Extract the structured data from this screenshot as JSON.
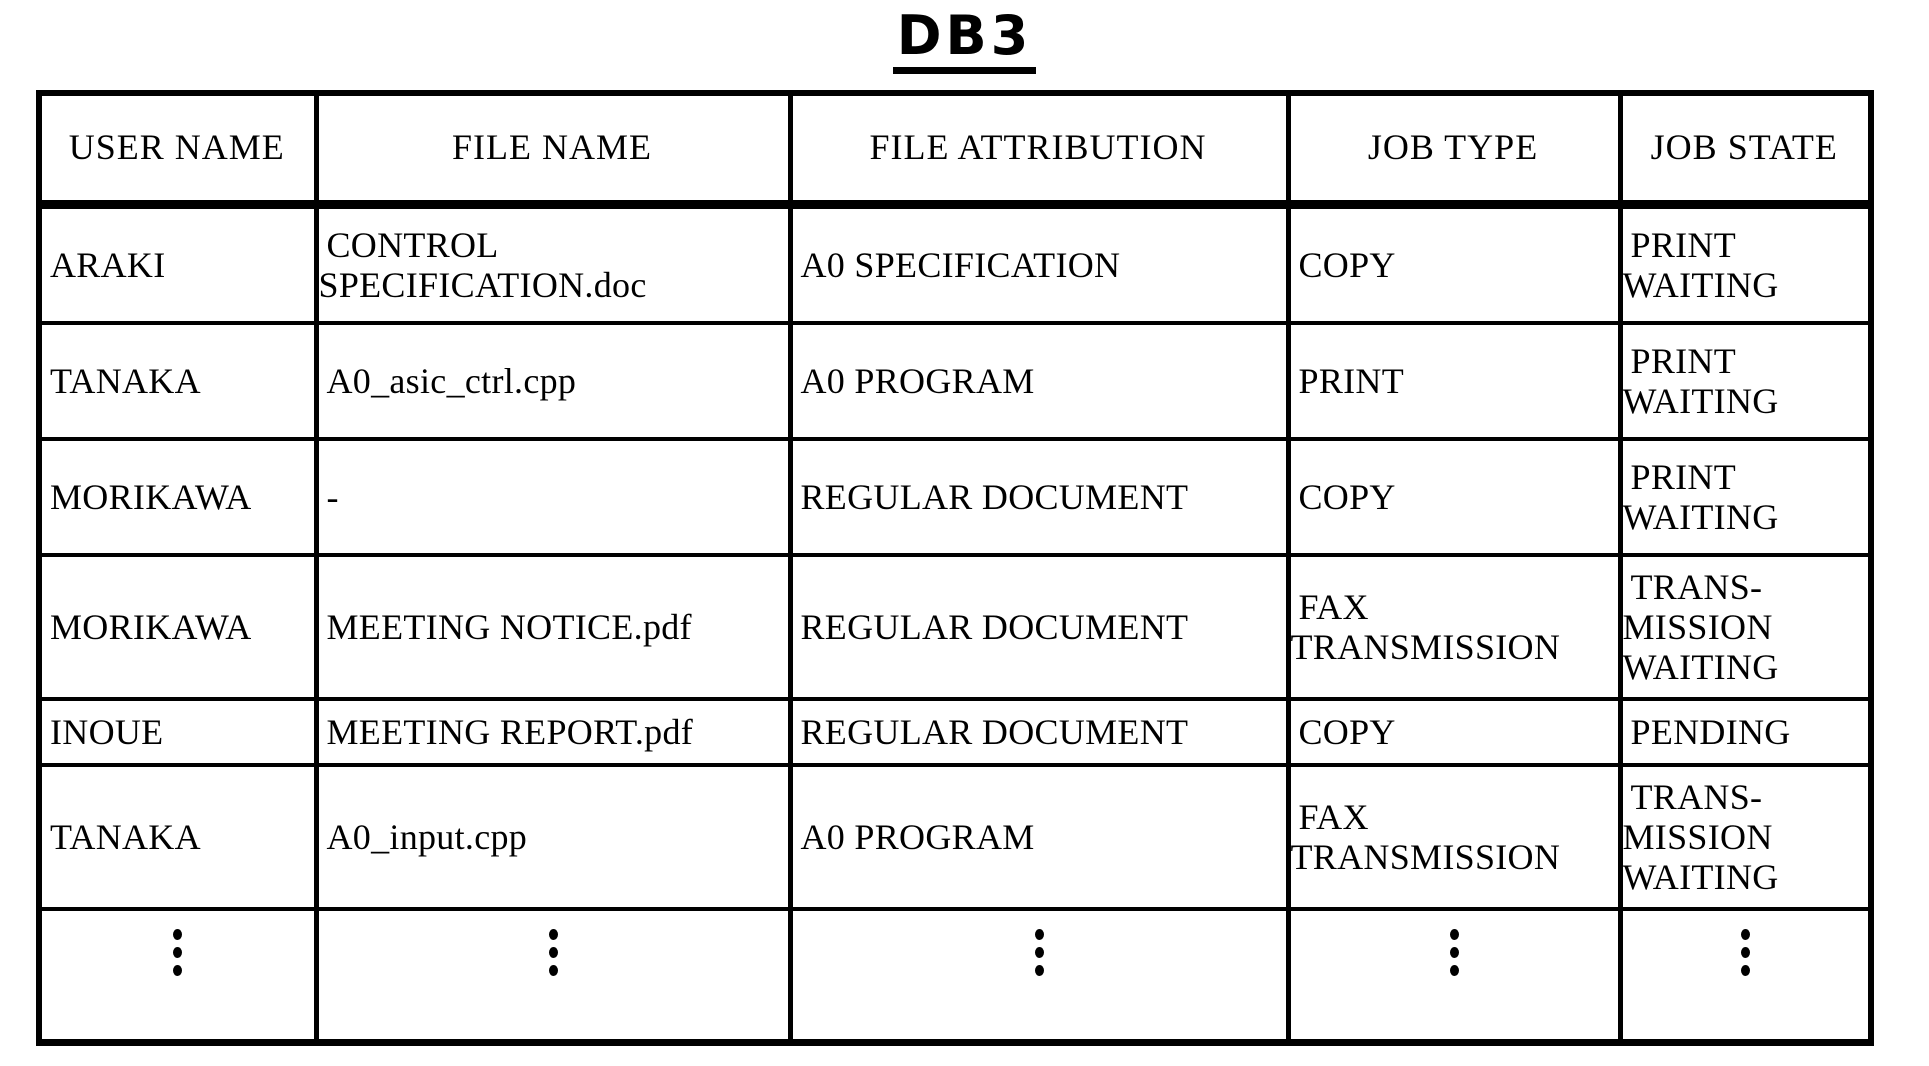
{
  "figure": {
    "title": "DB3"
  },
  "table": {
    "name": "job-database-table",
    "columns": [
      {
        "key": "user_name",
        "label": "USER NAME"
      },
      {
        "key": "file_name",
        "label": "FILE NAME"
      },
      {
        "key": "file_attribution",
        "label": "FILE ATTRIBUTION"
      },
      {
        "key": "job_type",
        "label": "JOB TYPE"
      },
      {
        "key": "job_state",
        "label": "JOB STATE"
      }
    ],
    "rows": [
      {
        "user_name": "ARAKI",
        "file_name": "CONTROL\nSPECIFICATION.doc",
        "file_attribution": "A0 SPECIFICATION",
        "job_type": "COPY",
        "job_state": "PRINT\nWAITING"
      },
      {
        "user_name": "TANAKA",
        "file_name": "A0_asic_ctrl.cpp",
        "file_attribution": "A0 PROGRAM",
        "job_type": "PRINT",
        "job_state": "PRINT\nWAITING"
      },
      {
        "user_name": "MORIKAWA",
        "file_name": "-",
        "file_attribution": "REGULAR DOCUMENT",
        "job_type": "COPY",
        "job_state": "PRINT\nWAITING"
      },
      {
        "user_name": "MORIKAWA",
        "file_name": "MEETING NOTICE.pdf",
        "file_attribution": "REGULAR DOCUMENT",
        "job_type": "FAX\nTRANSMISSION",
        "job_state": "TRANS-\nMISSION\nWAITING"
      },
      {
        "user_name": "INOUE",
        "file_name": "MEETING REPORT.pdf",
        "file_attribution": "REGULAR DOCUMENT",
        "job_type": "COPY",
        "job_state": "PENDING"
      },
      {
        "user_name": "TANAKA",
        "file_name": "A0_input.cpp",
        "file_attribution": "A0 PROGRAM",
        "job_type": "FAX\nTRANSMISSION",
        "job_state": "TRANS-\nMISSION\nWAITING"
      }
    ],
    "continuation_row": {
      "symbol": "vertical-ellipsis",
      "user_name": "⋮",
      "file_name": "⋮",
      "file_attribution": "⋮",
      "job_type": "⋮",
      "job_state": "⋮"
    }
  },
  "colors": {
    "ink": "#000000",
    "paper": "#ffffff"
  }
}
